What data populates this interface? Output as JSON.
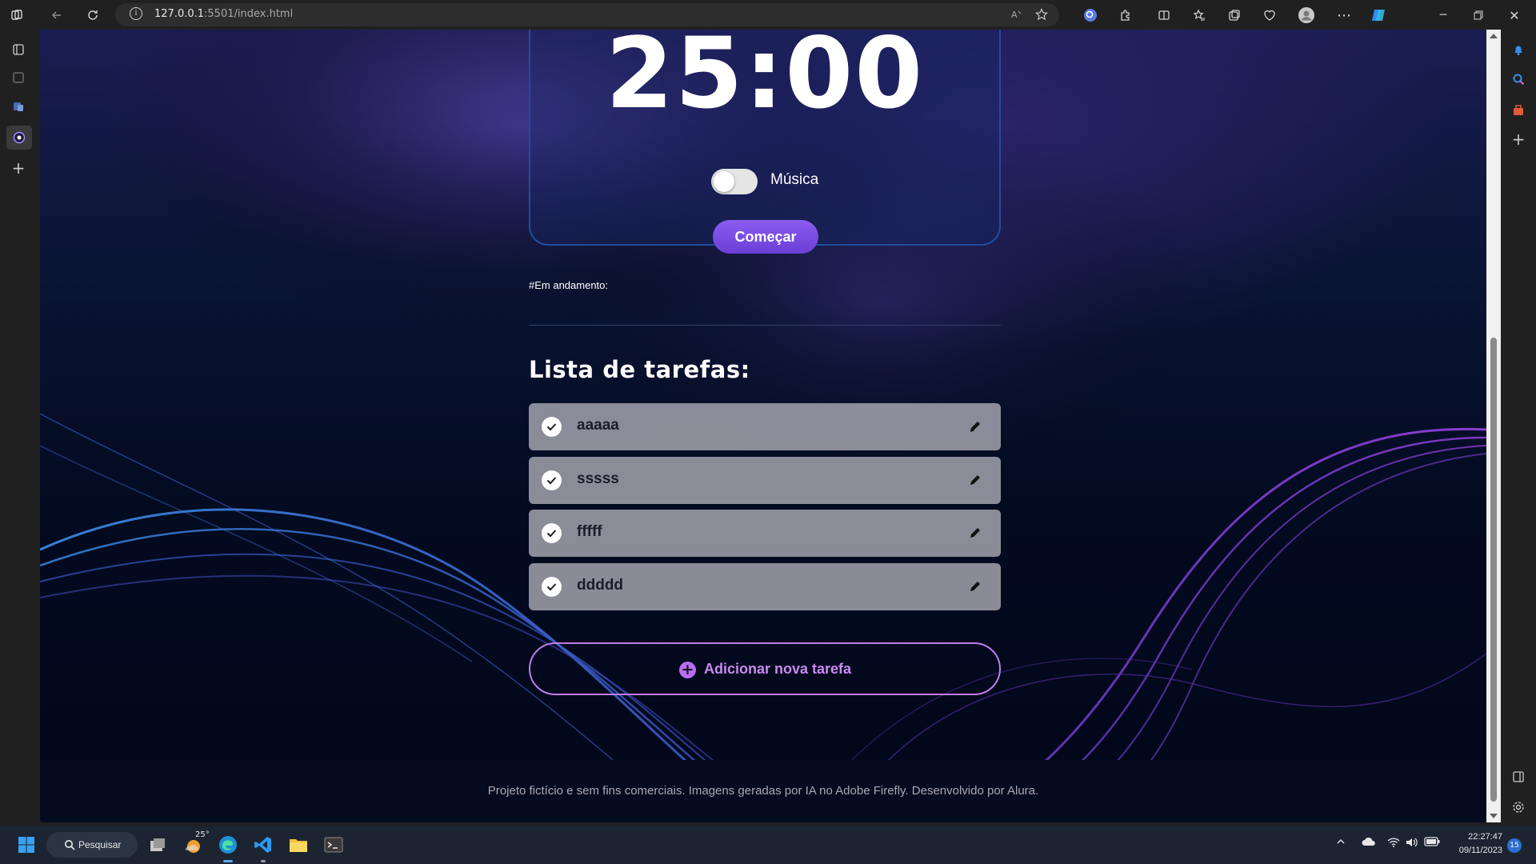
{
  "browser": {
    "url_host": "127.0.0.1",
    "url_rest": ":5501/index.html"
  },
  "timer": {
    "value": "25:00",
    "music_label": "Música",
    "music_enabled": false,
    "start_label": "Começar"
  },
  "in_progress_label": "#Em andamento:",
  "task_list": {
    "title": "Lista de tarefas:",
    "items": [
      {
        "text": "aaaaa"
      },
      {
        "text": "sssss"
      },
      {
        "text": "fffff"
      },
      {
        "text": "ddddd"
      }
    ],
    "add_label": "Adicionar nova tarefa"
  },
  "footer": {
    "text": "Projeto fictício e sem fins comerciais. Imagens geradas por IA no Adobe Firefly. Desenvolvido por Alura."
  },
  "taskbar": {
    "search_label": "Pesquisar",
    "weather_temp": "25°",
    "time": "22:27:47",
    "date": "09/11/2023",
    "notification_count": "15"
  },
  "colors": {
    "accent_purple": "#8a5cf0",
    "add_border": "#c07ce8",
    "task_bg": "#a8a8b2"
  }
}
